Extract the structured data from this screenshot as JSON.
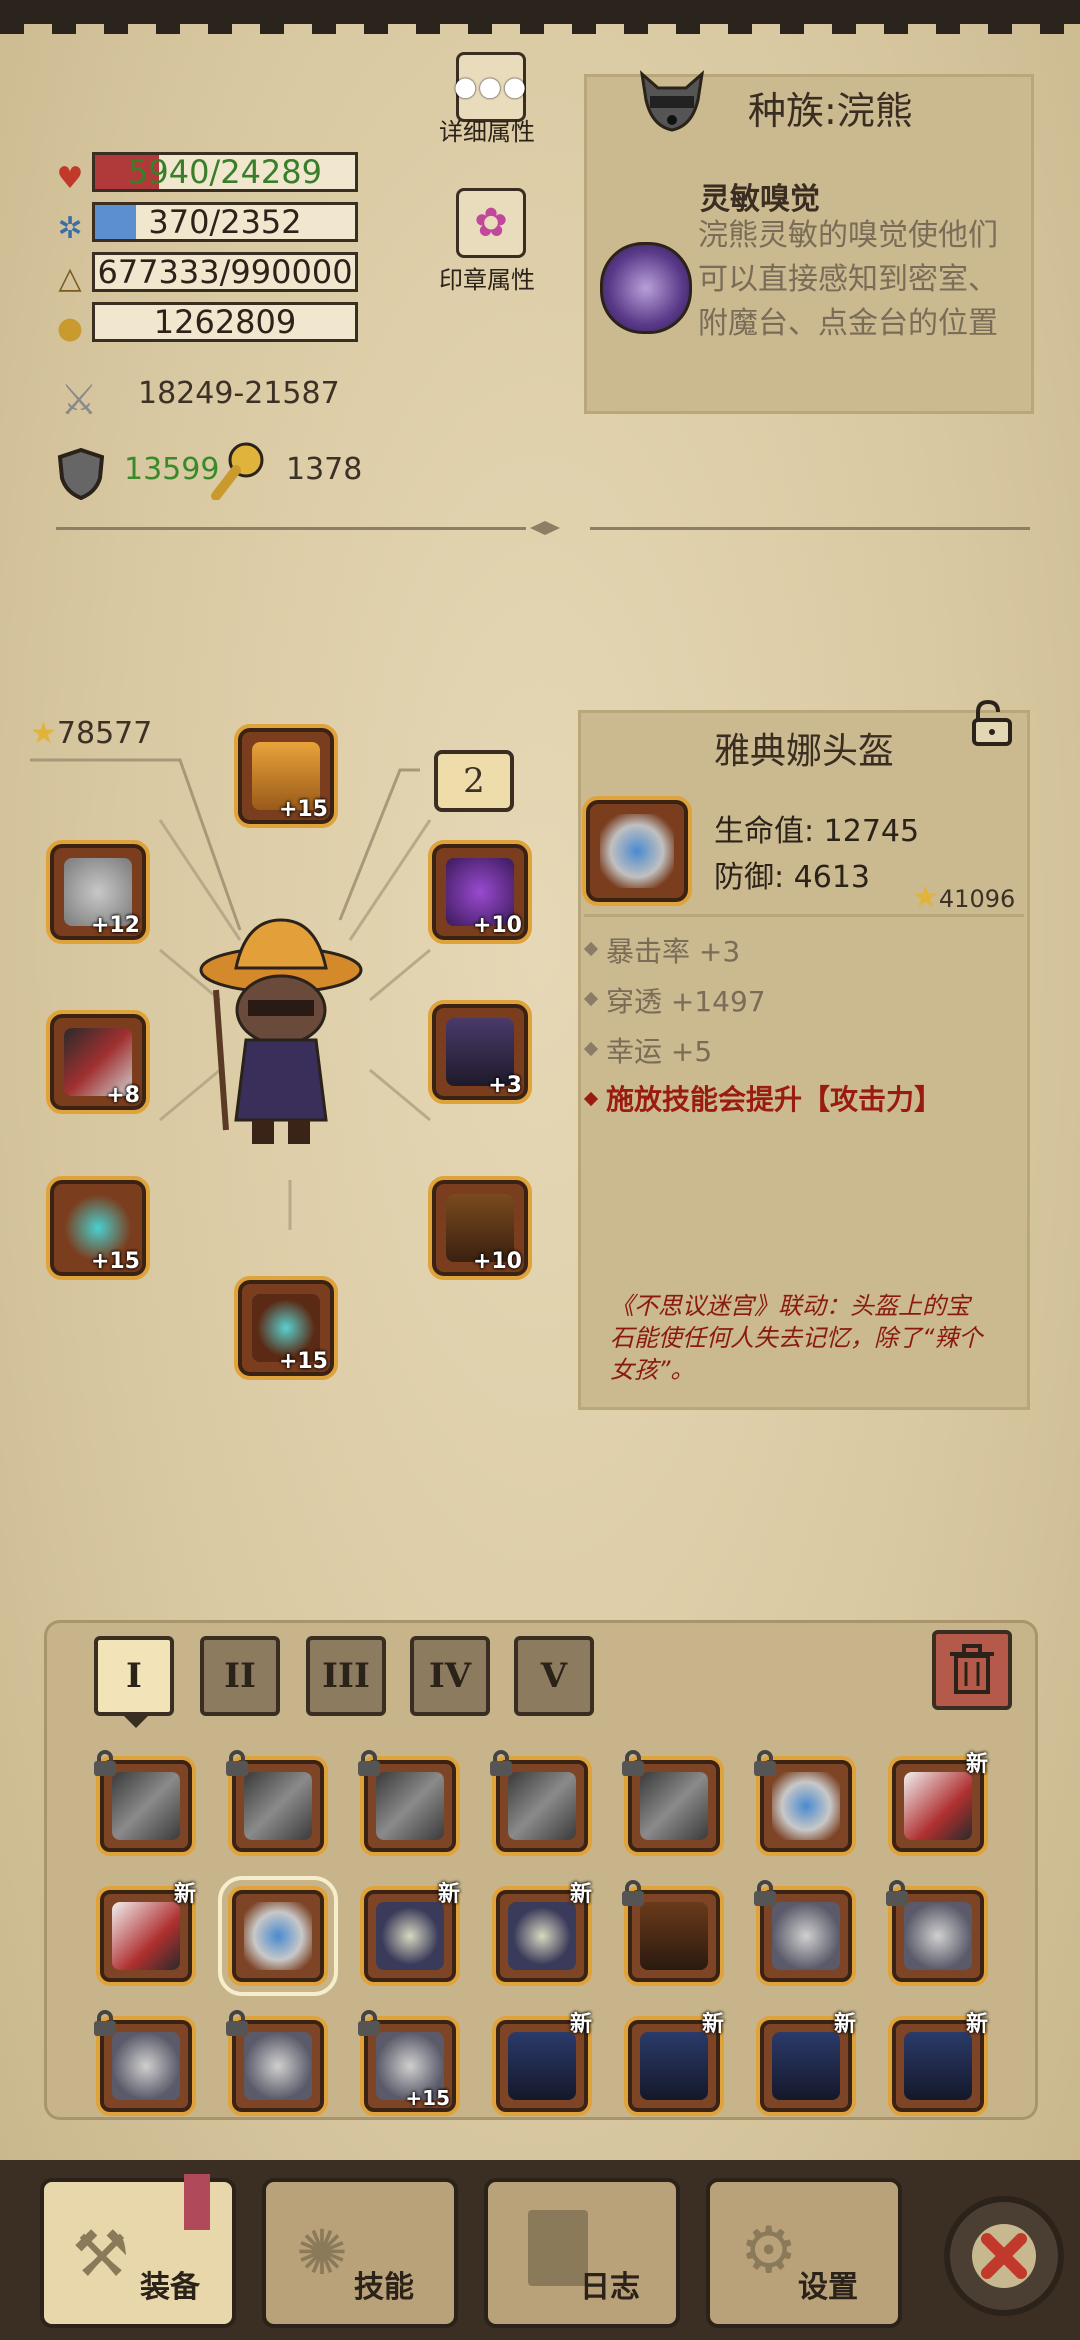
{
  "stats": {
    "hp": "5940/24289",
    "hp_fraction": 0.245,
    "mp": "370/2352",
    "mp_fraction": 0.157,
    "exp": "677333/990000",
    "exp_fraction": 0.684,
    "gold": "1262809",
    "attack": "18249-21587",
    "defense": "13599",
    "luck": "1378"
  },
  "top_buttons": {
    "details_label": "详细属性",
    "seal_label": "印章属性"
  },
  "race": {
    "title": "种族:浣熊",
    "skill_name": "灵敏嗅觉",
    "skill_desc": "浣熊灵敏的嗅觉使他们可以直接感知到密室、附魔台、点金台的位置"
  },
  "equipment": {
    "score": "78577",
    "page_label": "2",
    "slots": [
      {
        "name": "hat",
        "level": "+15"
      },
      {
        "name": "weapon-left",
        "level": "+12"
      },
      {
        "name": "necklace",
        "level": "+10"
      },
      {
        "name": "sword",
        "level": "+8"
      },
      {
        "name": "armor",
        "level": "+3"
      },
      {
        "name": "glove",
        "level": "+15"
      },
      {
        "name": "pants",
        "level": "+10"
      },
      {
        "name": "boots",
        "level": "+15"
      }
    ]
  },
  "item": {
    "name": "雅典娜头盔",
    "hp_line": "生命值: 12745",
    "def_line": "防御: 4613",
    "score": "41096",
    "attrs": [
      "暴击率 +3",
      "穿透 +1497",
      "幸运 +5"
    ],
    "special": "施放技能会提升【攻击力】",
    "flavor": "《不思议迷宫》联动：头盔上的宝石能使任何人失去记忆，除了“辣个女孩”。"
  },
  "inventory": {
    "tabs": [
      "I",
      "II",
      "III",
      "IV",
      "V"
    ],
    "active_tab": 0,
    "new_badge": "新",
    "rows": [
      [
        {
          "type": "sword",
          "locked": true
        },
        {
          "type": "sword",
          "locked": true
        },
        {
          "type": "sword",
          "locked": true
        },
        {
          "type": "sword",
          "locked": true
        },
        {
          "type": "sword",
          "locked": true
        },
        {
          "type": "helmet",
          "locked": true
        },
        {
          "type": "dagger",
          "new": true
        }
      ],
      [
        {
          "type": "dagger",
          "new": true
        },
        {
          "type": "helmet",
          "selected": true
        },
        {
          "type": "mask",
          "new": true
        },
        {
          "type": "mask",
          "new": true
        },
        {
          "type": "leather",
          "locked": true
        },
        {
          "type": "wings",
          "locked": true
        },
        {
          "type": "wings",
          "locked": true
        }
      ],
      [
        {
          "type": "wings",
          "locked": true
        },
        {
          "type": "wings",
          "locked": true
        },
        {
          "type": "wings",
          "locked": true,
          "level": "+15"
        },
        {
          "type": "plate",
          "new": true
        },
        {
          "type": "plate",
          "new": true
        },
        {
          "type": "plate",
          "new": true
        },
        {
          "type": "plate",
          "new": true
        }
      ]
    ]
  },
  "nav": {
    "equip": "装备",
    "skills": "技能",
    "log": "日志",
    "settings": "设置"
  },
  "colors": {
    "hp": "#b03a3a",
    "mp": "#5b8fd0",
    "hp_text": "#3a7d2a",
    "defense_text": "#3a8a2a",
    "slot_border": "#e0a33b",
    "red_text": "#9a1c10"
  }
}
